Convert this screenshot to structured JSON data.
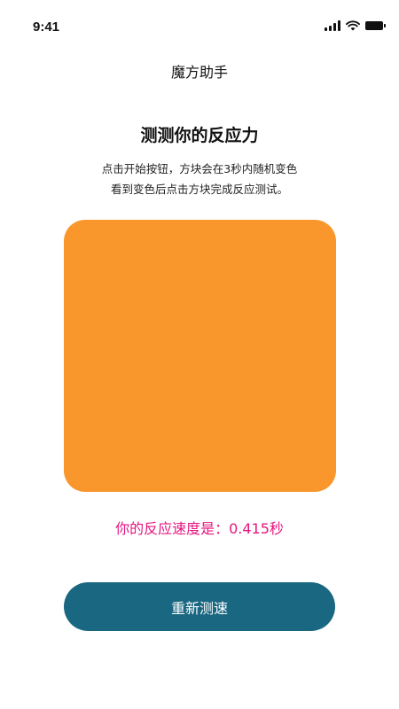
{
  "status_bar": {
    "time": "9:41",
    "icons": [
      "signal-icon",
      "wifi-icon",
      "battery-icon"
    ]
  },
  "header": {
    "title": "魔方助手"
  },
  "main": {
    "heading": "测测你的反应力",
    "description_line1": "点击开始按钮，方块会在3秒内随机变色",
    "description_line2": "看到变色后点击方块完成反应测试。",
    "result_text": "你的反应速度是：0.415秒",
    "restart_label": "重新测速"
  },
  "colors": {
    "block": "#F9962C",
    "result_text": "#E5157F",
    "button_bg": "#1A6781",
    "button_text": "#FFFFFF"
  }
}
